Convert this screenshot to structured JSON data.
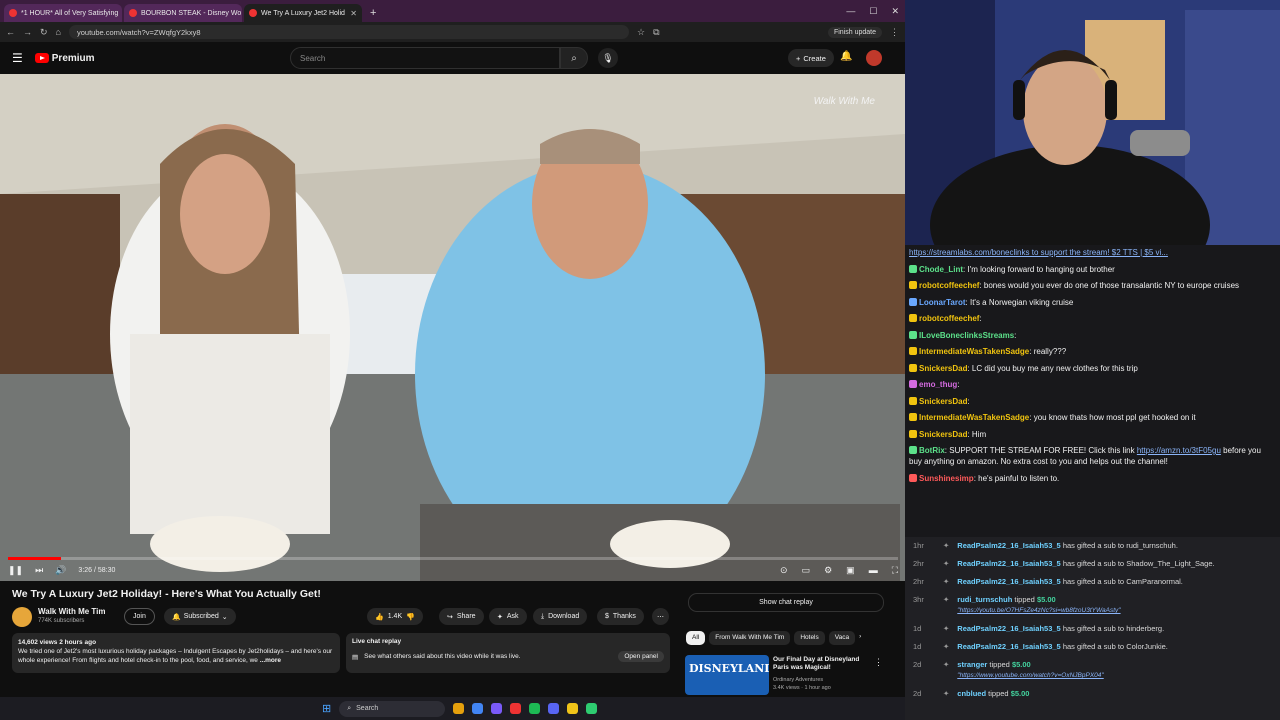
{
  "browser": {
    "tabs": [
      {
        "title": "*1 HOUR* All of Very Satisfying",
        "active": false
      },
      {
        "title": "BOURBON STEAK - Disney Wo",
        "active": false
      },
      {
        "title": "We Try A Luxury Jet2 Holid",
        "active": true
      }
    ],
    "new_tab": "+",
    "url": "youtube.com/watch?v=ZWqfgY2kxy8",
    "finish_update": "Finish update"
  },
  "youtube": {
    "logo_text": "Premium",
    "search_placeholder": "Search",
    "create_label": "Create",
    "video": {
      "watermark": "Walk With Me",
      "current_time": "3:26",
      "duration": "58:30",
      "progress_fraction": 0.059
    },
    "title": "We Try A Luxury Jet2 Holiday! - Here's What You Actually Get!",
    "channel": {
      "name": "Walk With Me Tim",
      "subscribers": "774K subscribers",
      "join_label": "Join",
      "subscribed_label": "Subscribed"
    },
    "actions": {
      "likes": "1.4K",
      "share": "Share",
      "ask": "Ask",
      "download": "Download",
      "thanks": "Thanks"
    },
    "description": {
      "meta": "14,602 views  2 hours ago",
      "text": "We tried one of Jet2's most luxurious holiday packages – Indulgent Escapes by Jet2holidays – and here's our whole experience! From flights and hotel check-in to the pool, food, and service, we",
      "more": "...more"
    },
    "live_chat": {
      "title": "Live chat replay",
      "text": "See what others said about this video while it was live.",
      "open_panel": "Open panel"
    },
    "show_chat_replay": "Show chat replay",
    "chips": [
      "All",
      "From Walk With Me Tim",
      "Hotels",
      "Vaca"
    ],
    "recommended": {
      "thumb_text": "DISNEYLAND",
      "title": "Our Final Day at Disneyland Paris was Magical!",
      "channel": "Ordinary Adventures",
      "meta": "3.4K views · 1 hour ago"
    }
  },
  "stream_chat": {
    "banner": "https://streamlabs.com/boneclinks to support the stream! $2 TTS | $5 vi...",
    "messages": [
      {
        "user": "Chode_Lint",
        "color": "#5ce18a",
        "text": "I'm looking forward to hanging out brother"
      },
      {
        "user": "robotcoffeechef",
        "color": "#f1c40f",
        "text": "bones would you ever do one of those transalantic NY to europe cruises"
      },
      {
        "user": "LoonarTarot",
        "color": "#6aa8ff",
        "text": "It's a Norwegian viking cruise"
      },
      {
        "user": "robotcoffeechef",
        "color": "#f1c40f",
        "text": ""
      },
      {
        "user": "ILoveBoneclinksStreams",
        "color": "#5ce18a",
        "text": ""
      },
      {
        "user": "IntermediateWasTakenSadge",
        "color": "#f1c40f",
        "text": "really???"
      },
      {
        "user": "SnickersDad",
        "color": "#f1c40f",
        "text": "LC did you buy me any new clothes for this trip"
      },
      {
        "user": "emo_thug",
        "color": "#d46be0",
        "text": ""
      },
      {
        "user": "SnickersDad",
        "color": "#f1c40f",
        "text": ""
      },
      {
        "user": "IntermediateWasTakenSadge",
        "color": "#f1c40f",
        "text": "you know thats how most ppl get hooked on it"
      },
      {
        "user": "SnickersDad",
        "color": "#f1c40f",
        "text": "Him"
      },
      {
        "user": "BotRix",
        "color": "#5ce18a",
        "text": "SUPPORT THE STREAM FOR FREE! Click this link",
        "link": "https://amzn.to/3tF05gu",
        "after": "before you buy anything on amazon. No extra cost to you and helps out the channel!"
      },
      {
        "user": "Sunshinesimp",
        "color": "#ff5a5a",
        "text": "he's painful to listen to."
      }
    ]
  },
  "stream_events": [
    {
      "time": "1hr",
      "who": "ReadPsalm22_16_Isaiah53_5",
      "text": "has gifted a sub to",
      "target": "rudi_turnschuh."
    },
    {
      "time": "2hr",
      "who": "ReadPsalm22_16_Isaiah53_5",
      "text": "has gifted a sub to",
      "target": "Shadow_The_Light_Sage."
    },
    {
      "time": "2hr",
      "who": "ReadPsalm22_16_Isaiah53_5",
      "text": "has gifted a sub to",
      "target": "CamParanormal."
    },
    {
      "time": "3hr",
      "who": "rudi_turnschuh",
      "text": "tipped",
      "amount": "$5.00",
      "sub": "\"https://youtu.be/O7HFsZe4zNc?si=wb8fzoU3tYWaAsty\""
    },
    {
      "time": "1d",
      "who": "ReadPsalm22_16_Isaiah53_5",
      "text": "has gifted a sub to",
      "target": "hinderberg."
    },
    {
      "time": "1d",
      "who": "ReadPsalm22_16_Isaiah53_5",
      "text": "has gifted a sub to",
      "target": "ColorJunkie."
    },
    {
      "time": "2d",
      "who": "stranger",
      "text": "tipped",
      "amount": "$5.00",
      "sub": "\"https://www.youtube.com/watch?v=OxNJBpPX04\""
    },
    {
      "time": "2d",
      "who": "cnblued",
      "text": "tipped",
      "amount": "$5.00",
      "sub": ""
    }
  ],
  "taskbar": {
    "search_label": "Search"
  },
  "colors": {
    "yt_red": "#ff0000",
    "bg": "#0f0f0f",
    "chat_bg": "#18181b"
  }
}
